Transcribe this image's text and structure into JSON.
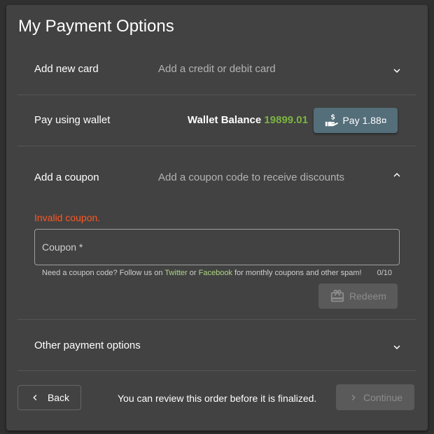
{
  "page": {
    "title": "My Payment Options"
  },
  "sections": {
    "add_card": {
      "label": "Add new card",
      "description": "Add a credit or debit card",
      "expand_icon": "chevron-down-icon"
    },
    "wallet": {
      "label": "Pay using wallet",
      "balance_label": "Wallet Balance",
      "balance_value": "19899.01",
      "pay_button_label": "Pay 1.88¤",
      "pay_icon": "hand-dollar-icon"
    },
    "coupon": {
      "label": "Add a coupon",
      "description": "Add a coupon code to receive discounts",
      "collapse_icon": "chevron-up-icon",
      "error": "Invalid coupon.",
      "input_placeholder": "Coupon *",
      "input_value": "",
      "helper_prefix": "Need a coupon code? Follow us on ",
      "helper_link1": "Twitter",
      "helper_mid": " or ",
      "helper_link2": "Facebook",
      "helper_suffix": " for monthly coupons and other spam!",
      "char_counter": "0/10",
      "redeem_label": "Redeem",
      "redeem_icon": "gift-icon"
    },
    "other": {
      "label": "Other payment options",
      "expand_icon": "chevron-down-icon"
    }
  },
  "footer": {
    "back_label": "Back",
    "review_text": "You can review this order before it is finalized.",
    "continue_label": "Continue"
  },
  "colors": {
    "background": "#303030",
    "card": "#424242",
    "accent_green": "#7cb342",
    "link_green": "#aed581",
    "error": "#ff5722",
    "pay_button": "#546e7a",
    "disabled_button": "#5a5a5a"
  }
}
